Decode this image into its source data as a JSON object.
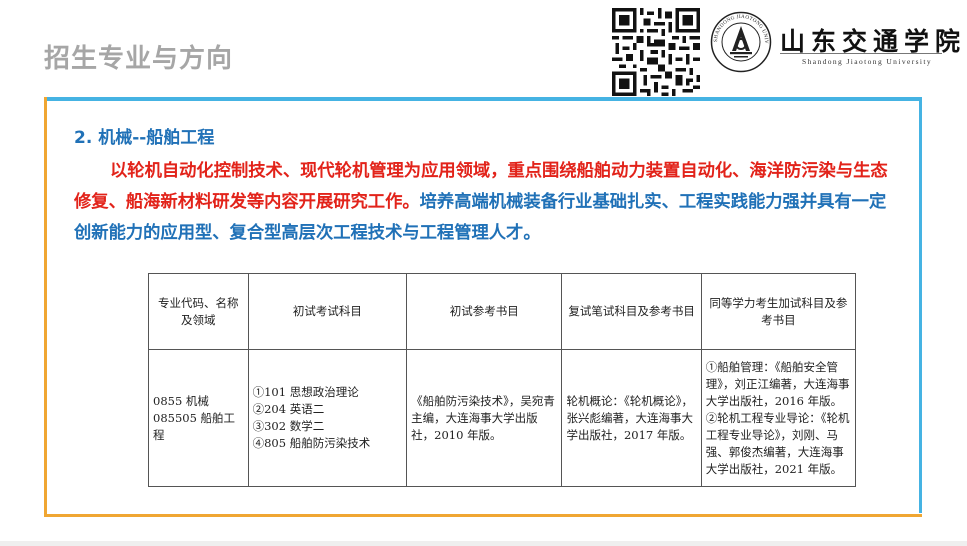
{
  "slide_title": "招生专业与方向",
  "logo": {
    "school_name_cn": "山东交通学院",
    "school_name_en": "Shandong  Jiaotong  University",
    "seal_ring_text": "SHANDONG JIAOTONG UNIVERSITY"
  },
  "section": {
    "heading": "2. 机械--船舶工程",
    "paragraph_red": "以轮机自动化控制技术、现代轮机管理为应用领域，重点围绕船舶动力装置自动化、海洋防污染与生态修复、船海新材料研发等内容开展研究工作。",
    "paragraph_blue": "培养高端机械装备行业基础扎实、工程实践能力强并具有一定创新能力的应用型、复合型高层次工程技术与工程管理人才。"
  },
  "table": {
    "headers": [
      "专业代码、名称及领域",
      "初试考试科目",
      "初试参考书目",
      "复试笔试科目及参考书目",
      "同等学力考生加试科目及参考书目"
    ],
    "row": {
      "major": [
        "0855 机械",
        "085505 船舶工程"
      ],
      "exam_subjects": [
        "①101 思想政治理论",
        "②204 英语二",
        "③302 数学二",
        "④805 船舶防污染技术"
      ],
      "exam_reference": "《船舶防污染技术》，吴宛青主编，大连海事大学出版社，2010 年版。",
      "retest": "轮机概论：《轮机概论》，张兴彪编著，大连海事大学出版社，2017 年版。",
      "equivalent": [
        "①船舶管理：《船舶安全管理》，刘正江编著，大连海事大学出版社，2016 年版。",
        "②轮机工程专业导论：《轮机工程专业导论》，刘刚、马强、郭俊杰编著，大连海事大学出版社，2021 年版。"
      ]
    }
  },
  "colors": {
    "frame_blue": "#45b3e3",
    "frame_orange": "#f0a632",
    "heading_blue": "#2071b7",
    "text_red": "#e2231a",
    "title_gray": "#a6a6a6"
  },
  "icons": [
    "qr-code-icon",
    "university-seal-icon"
  ]
}
